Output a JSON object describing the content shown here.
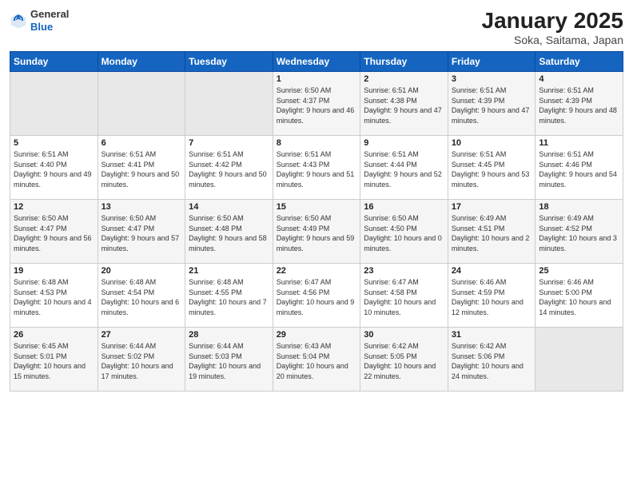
{
  "header": {
    "logo_line1": "General",
    "logo_line2": "Blue",
    "title": "January 2025",
    "subtitle": "Soka, Saitama, Japan"
  },
  "weekdays": [
    "Sunday",
    "Monday",
    "Tuesday",
    "Wednesday",
    "Thursday",
    "Friday",
    "Saturday"
  ],
  "weeks": [
    [
      {
        "day": "",
        "empty": true
      },
      {
        "day": "",
        "empty": true
      },
      {
        "day": "",
        "empty": true
      },
      {
        "day": "1",
        "sunrise": "6:50 AM",
        "sunset": "4:37 PM",
        "daylight": "9 hours and 46 minutes."
      },
      {
        "day": "2",
        "sunrise": "6:51 AM",
        "sunset": "4:38 PM",
        "daylight": "9 hours and 47 minutes."
      },
      {
        "day": "3",
        "sunrise": "6:51 AM",
        "sunset": "4:39 PM",
        "daylight": "9 hours and 47 minutes."
      },
      {
        "day": "4",
        "sunrise": "6:51 AM",
        "sunset": "4:39 PM",
        "daylight": "9 hours and 48 minutes."
      }
    ],
    [
      {
        "day": "5",
        "sunrise": "6:51 AM",
        "sunset": "4:40 PM",
        "daylight": "9 hours and 49 minutes."
      },
      {
        "day": "6",
        "sunrise": "6:51 AM",
        "sunset": "4:41 PM",
        "daylight": "9 hours and 50 minutes."
      },
      {
        "day": "7",
        "sunrise": "6:51 AM",
        "sunset": "4:42 PM",
        "daylight": "9 hours and 50 minutes."
      },
      {
        "day": "8",
        "sunrise": "6:51 AM",
        "sunset": "4:43 PM",
        "daylight": "9 hours and 51 minutes."
      },
      {
        "day": "9",
        "sunrise": "6:51 AM",
        "sunset": "4:44 PM",
        "daylight": "9 hours and 52 minutes."
      },
      {
        "day": "10",
        "sunrise": "6:51 AM",
        "sunset": "4:45 PM",
        "daylight": "9 hours and 53 minutes."
      },
      {
        "day": "11",
        "sunrise": "6:51 AM",
        "sunset": "4:46 PM",
        "daylight": "9 hours and 54 minutes."
      }
    ],
    [
      {
        "day": "12",
        "sunrise": "6:50 AM",
        "sunset": "4:47 PM",
        "daylight": "9 hours and 56 minutes."
      },
      {
        "day": "13",
        "sunrise": "6:50 AM",
        "sunset": "4:47 PM",
        "daylight": "9 hours and 57 minutes."
      },
      {
        "day": "14",
        "sunrise": "6:50 AM",
        "sunset": "4:48 PM",
        "daylight": "9 hours and 58 minutes."
      },
      {
        "day": "15",
        "sunrise": "6:50 AM",
        "sunset": "4:49 PM",
        "daylight": "9 hours and 59 minutes."
      },
      {
        "day": "16",
        "sunrise": "6:50 AM",
        "sunset": "4:50 PM",
        "daylight": "10 hours and 0 minutes."
      },
      {
        "day": "17",
        "sunrise": "6:49 AM",
        "sunset": "4:51 PM",
        "daylight": "10 hours and 2 minutes."
      },
      {
        "day": "18",
        "sunrise": "6:49 AM",
        "sunset": "4:52 PM",
        "daylight": "10 hours and 3 minutes."
      }
    ],
    [
      {
        "day": "19",
        "sunrise": "6:48 AM",
        "sunset": "4:53 PM",
        "daylight": "10 hours and 4 minutes."
      },
      {
        "day": "20",
        "sunrise": "6:48 AM",
        "sunset": "4:54 PM",
        "daylight": "10 hours and 6 minutes."
      },
      {
        "day": "21",
        "sunrise": "6:48 AM",
        "sunset": "4:55 PM",
        "daylight": "10 hours and 7 minutes."
      },
      {
        "day": "22",
        "sunrise": "6:47 AM",
        "sunset": "4:56 PM",
        "daylight": "10 hours and 9 minutes."
      },
      {
        "day": "23",
        "sunrise": "6:47 AM",
        "sunset": "4:58 PM",
        "daylight": "10 hours and 10 minutes."
      },
      {
        "day": "24",
        "sunrise": "6:46 AM",
        "sunset": "4:59 PM",
        "daylight": "10 hours and 12 minutes."
      },
      {
        "day": "25",
        "sunrise": "6:46 AM",
        "sunset": "5:00 PM",
        "daylight": "10 hours and 14 minutes."
      }
    ],
    [
      {
        "day": "26",
        "sunrise": "6:45 AM",
        "sunset": "5:01 PM",
        "daylight": "10 hours and 15 minutes."
      },
      {
        "day": "27",
        "sunrise": "6:44 AM",
        "sunset": "5:02 PM",
        "daylight": "10 hours and 17 minutes."
      },
      {
        "day": "28",
        "sunrise": "6:44 AM",
        "sunset": "5:03 PM",
        "daylight": "10 hours and 19 minutes."
      },
      {
        "day": "29",
        "sunrise": "6:43 AM",
        "sunset": "5:04 PM",
        "daylight": "10 hours and 20 minutes."
      },
      {
        "day": "30",
        "sunrise": "6:42 AM",
        "sunset": "5:05 PM",
        "daylight": "10 hours and 22 minutes."
      },
      {
        "day": "31",
        "sunrise": "6:42 AM",
        "sunset": "5:06 PM",
        "daylight": "10 hours and 24 minutes."
      },
      {
        "day": "",
        "empty": true
      }
    ]
  ]
}
